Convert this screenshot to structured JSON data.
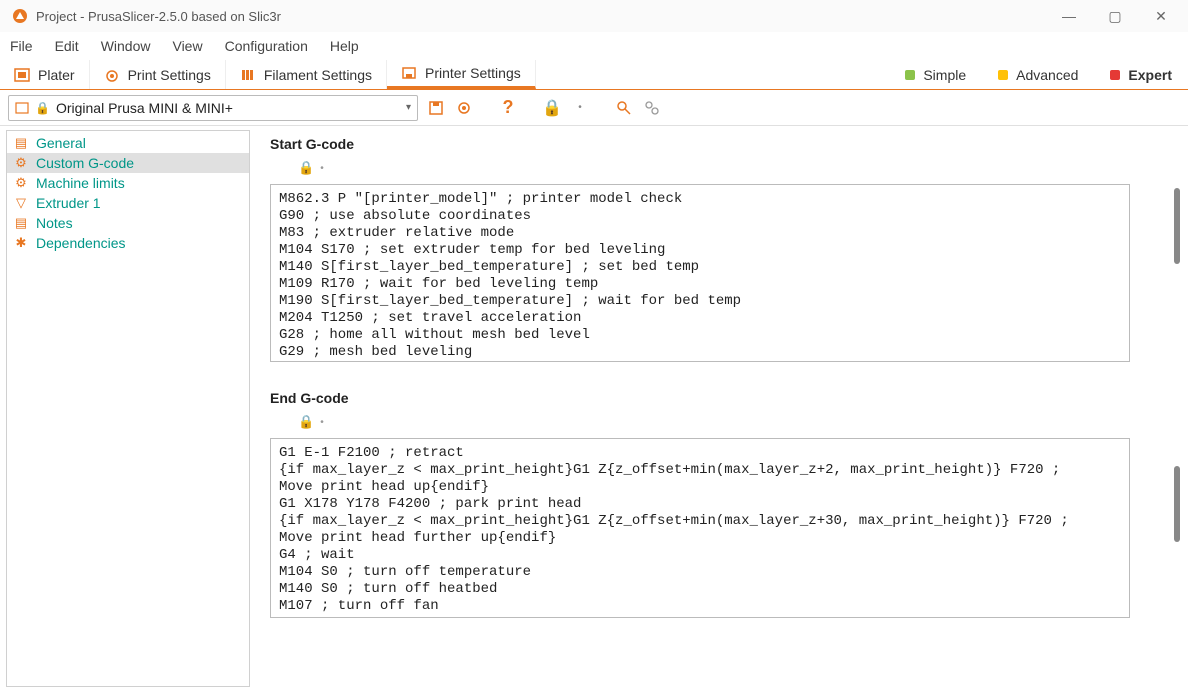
{
  "window": {
    "title": "Project - PrusaSlicer-2.5.0 based on Slic3r"
  },
  "menu": {
    "file": "File",
    "edit": "Edit",
    "window": "Window",
    "view": "View",
    "configuration": "Configuration",
    "help": "Help"
  },
  "tabs": {
    "plater": "Plater",
    "print": "Print Settings",
    "filament": "Filament Settings",
    "printer": "Printer Settings"
  },
  "modes": {
    "simple": "Simple",
    "advanced": "Advanced",
    "expert": "Expert"
  },
  "preset": {
    "name": "Original Prusa MINI & MINI+"
  },
  "sidebar": {
    "general": "General",
    "custom_gcode": "Custom G-code",
    "machine_limits": "Machine limits",
    "extruder1": "Extruder 1",
    "notes": "Notes",
    "dependencies": "Dependencies"
  },
  "sections": {
    "start": {
      "title": "Start G-code",
      "code": "M862.3 P \"[printer_model]\" ; printer model check\nG90 ; use absolute coordinates\nM83 ; extruder relative mode\nM104 S170 ; set extruder temp for bed leveling\nM140 S[first_layer_bed_temperature] ; set bed temp\nM109 R170 ; wait for bed leveling temp\nM190 S[first_layer_bed_temperature] ; wait for bed temp\nM204 T1250 ; set travel acceleration\nG28 ; home all without mesh bed level\nG29 ; mesh bed leveling"
    },
    "end": {
      "title": "End G-code",
      "code": "G1 E-1 F2100 ; retract\n{if max_layer_z < max_print_height}G1 Z{z_offset+min(max_layer_z+2, max_print_height)} F720 ;\nMove print head up{endif}\nG1 X178 Y178 F4200 ; park print head\n{if max_layer_z < max_print_height}G1 Z{z_offset+min(max_layer_z+30, max_print_height)} F720 ;\nMove print head further up{endif}\nG4 ; wait\nM104 S0 ; turn off temperature\nM140 S0 ; turn off heatbed\nM107 ; turn off fan"
    }
  }
}
